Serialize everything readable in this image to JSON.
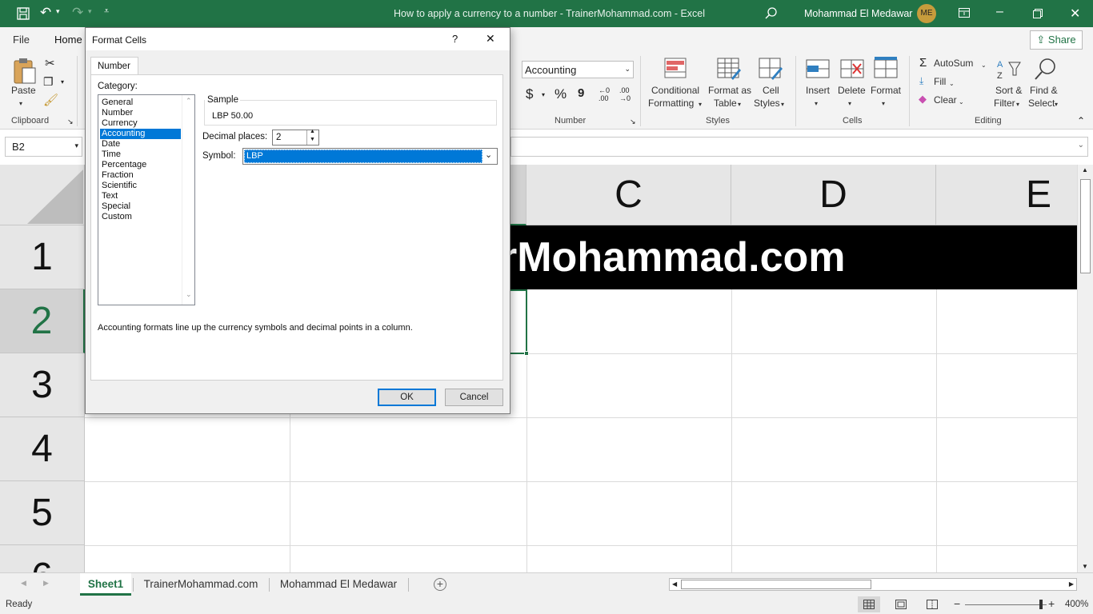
{
  "window": {
    "title": "How to apply a currency to a number - TrainerMohammad.com  -  Excel",
    "user": "Mohammad El Medawar",
    "user_initials": "ME"
  },
  "menu": {
    "file": "File",
    "home": "Home",
    "share": "Share"
  },
  "ribbon": {
    "paste": "Paste",
    "clipboard_group": "Clipboard",
    "number_format": "Accounting",
    "dollar": "$",
    "percent": "%",
    "comma": "9",
    "inc_decimal": "←0 .00",
    "dec_decimal": ".00 →0",
    "number_group": "Number",
    "conditional_formatting": [
      "Conditional",
      "Formatting"
    ],
    "format_as_table": [
      "Format as",
      "Table"
    ],
    "cell_styles": [
      "Cell",
      "Styles"
    ],
    "styles_group": "Styles",
    "insert": "Insert",
    "delete": "Delete",
    "format": "Format",
    "cells_group": "Cells",
    "autosum": "AutoSum",
    "fill": "Fill",
    "clear": "Clear",
    "sort_filter": [
      "Sort &",
      "Filter"
    ],
    "find_select": [
      "Find &",
      "Select"
    ],
    "editing_group": "Editing"
  },
  "name_box": "B2",
  "grid": {
    "columns": [
      "C",
      "D",
      "E"
    ],
    "rows": [
      "1",
      "2",
      "3",
      "4",
      "5",
      "6"
    ],
    "banner_text": "rMohammad.com"
  },
  "sheets": [
    "Sheet1",
    "TrainerMohammad.com",
    "Mohammad El Medawar"
  ],
  "status": {
    "ready": "Ready",
    "zoom": "400%"
  },
  "dialog": {
    "title": "Format Cells",
    "help": "?",
    "close": "✕",
    "tab": "Number",
    "category_label": "Category:",
    "categories": [
      "General",
      "Number",
      "Currency",
      "Accounting",
      "Date",
      "Time",
      "Percentage",
      "Fraction",
      "Scientific",
      "Text",
      "Special",
      "Custom"
    ],
    "selected_category": "Accounting",
    "sample_label": "Sample",
    "sample_value": "LBP 50.00",
    "decimal_label": "Decimal places:",
    "decimal_value": "2",
    "symbol_label": "Symbol:",
    "symbol_value": "LBP",
    "description": "Accounting formats line up the currency symbols and decimal points in a column.",
    "ok": "OK",
    "cancel": "Cancel"
  }
}
